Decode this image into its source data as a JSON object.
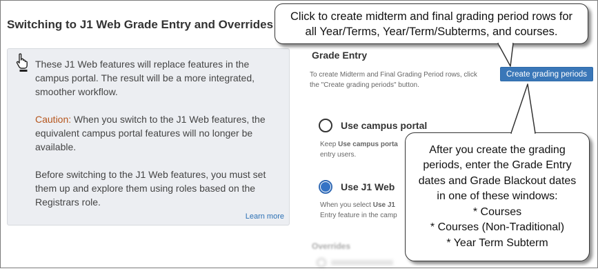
{
  "page": {
    "title": "Switching to J1 Web Grade Entry and Overrides"
  },
  "info": {
    "icon": "pointing-hand-icon",
    "paragraph1": "These J1 Web features will replace features in the campus portal. The result will be a more integrated, smoother workflow.",
    "caution_label": "Caution:",
    "caution_text": " When you switch to the J1 Web features, the equivalent campus portal features will no longer be available.",
    "paragraph3": "Before switching to the J1 Web features, you must set them up and explore them using roles based on the Registrars role.",
    "learn_more": "Learn more"
  },
  "grade_entry": {
    "title": "Grade Entry",
    "description": "To create Midterm and Final Grading Period rows, click the \"Create grading periods\" button.",
    "create_button": "Create grading periods",
    "options": [
      {
        "label": "Use campus portal",
        "selected": false,
        "desc_line1_prefix": "Keep ",
        "desc_line1_bold": "Use campus porta",
        "desc_line2": "entry users."
      },
      {
        "label": "Use J1 Web",
        "selected": true,
        "desc_line1_prefix": "When you select ",
        "desc_line1_bold": "Use J1",
        "desc_line2": "Entry feature in the camp"
      }
    ]
  },
  "overrides": {
    "title": "Overrides"
  },
  "callouts": {
    "top": "Click to create midterm and final grading period rows for all Year/Terms, Year/Term/Subterms, and courses.",
    "right_lines": [
      "After you create the grading",
      "periods, enter the Grade Entry",
      "dates and Grade Blackout dates",
      "in one of these windows:",
      "* Courses",
      "* Courses (Non-Traditional)",
      "* Year Term Subterm"
    ]
  },
  "colors": {
    "primary_button": "#3a77b8",
    "radio_selected": "#3473c5",
    "caution": "#b5541b",
    "link": "#2a6fb4",
    "info_box_bg": "#eceef2"
  }
}
